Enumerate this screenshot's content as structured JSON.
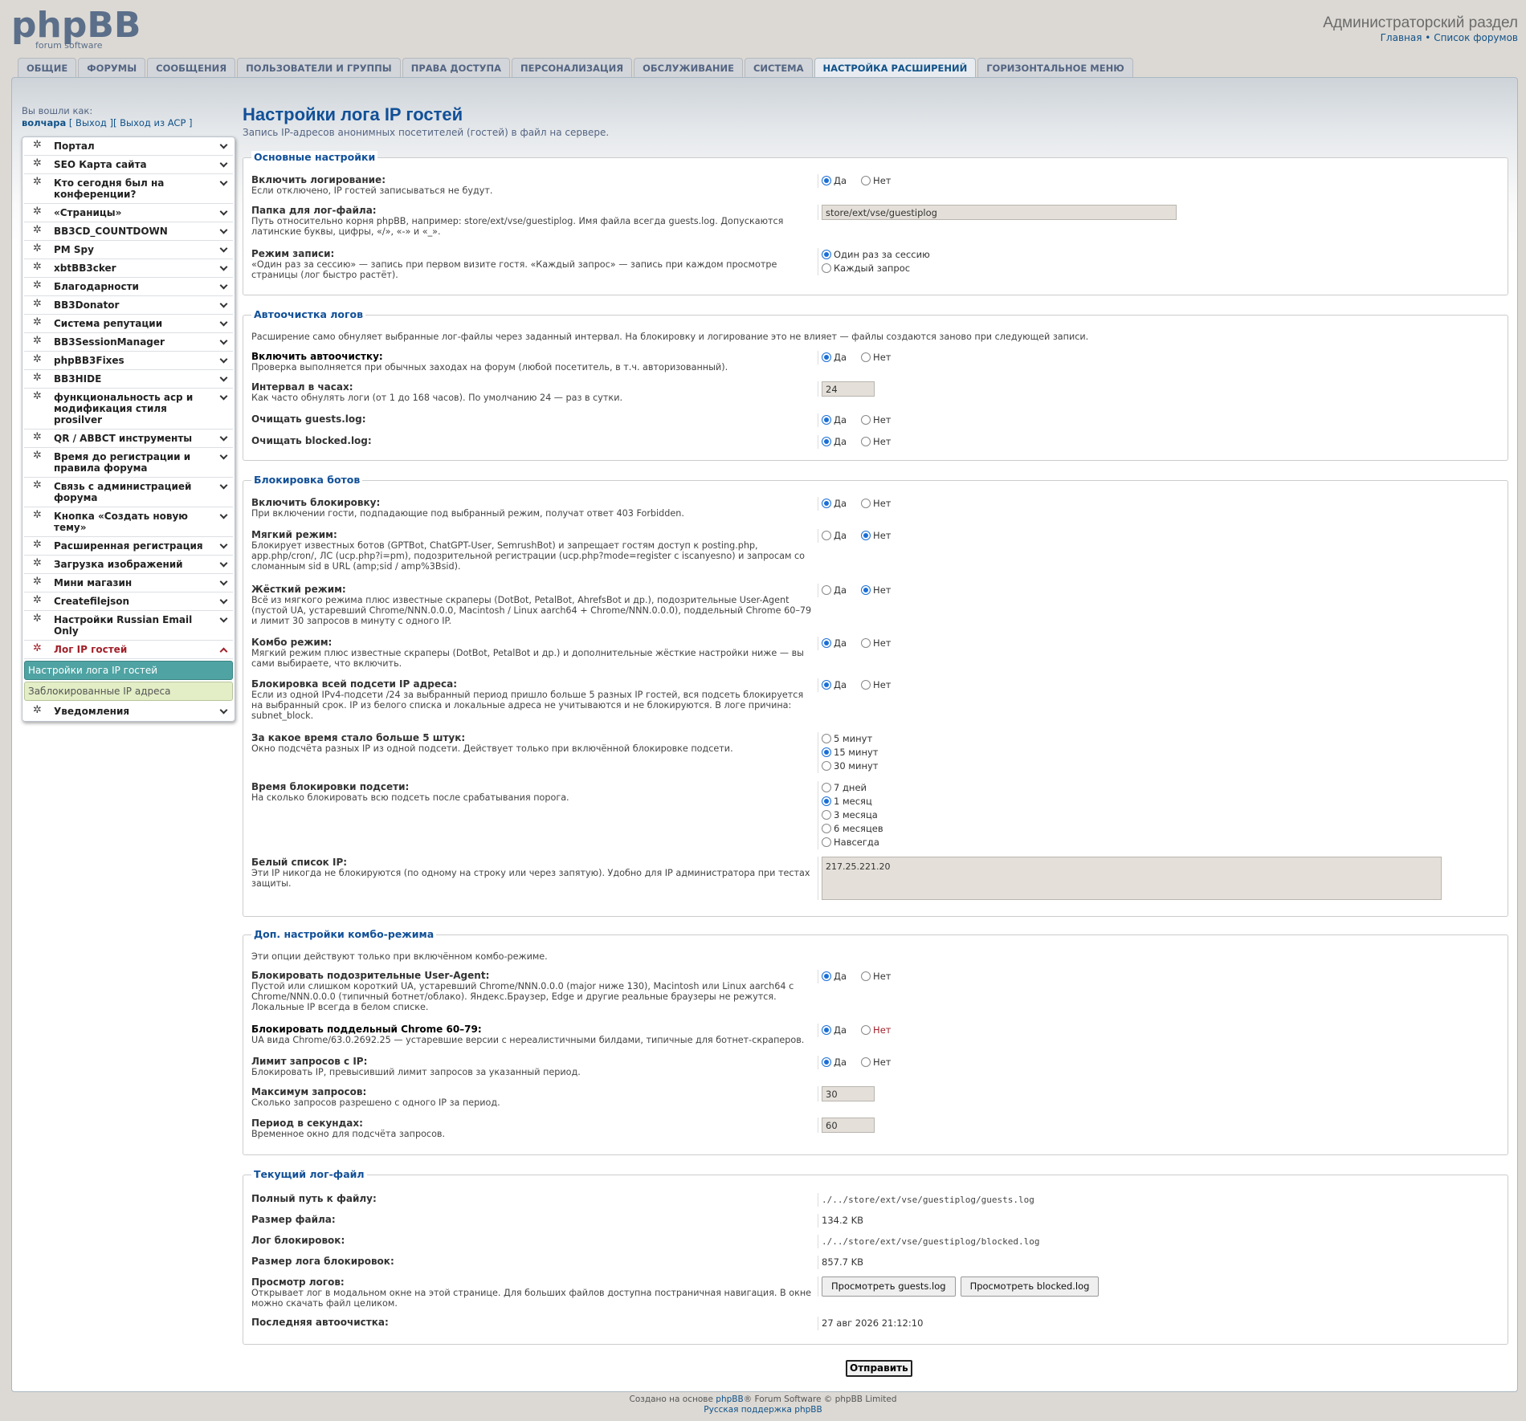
{
  "header": {
    "logo_text": "phpBB",
    "logo_sub": "forum software",
    "acp_title": "Администраторский раздел",
    "link_home": "Главная",
    "link_sep": "•",
    "link_forums": "Список форумов"
  },
  "tabs": [
    "Общие",
    "Форумы",
    "Сообщения",
    "Пользователи и группы",
    "Права доступа",
    "Персонализация",
    "Обслуживание",
    "Система",
    "Настройка расширений",
    "Горизонтальное меню"
  ],
  "login": {
    "label": "Вы вошли как:",
    "user": "волчара",
    "logout": "[ Выход ]",
    "logout_acp": "[ Выход из ACP ]"
  },
  "menu": [
    "Портал",
    "SEO Карта сайта",
    "Кто сегодня был на конференции?",
    "«Страницы»",
    "BB3CD_COUNTDOWN",
    "PM Spy",
    "xbtBB3cker",
    "Благодарности",
    "BB3Donator",
    "Система репутации",
    "BB3SessionManager",
    "phpBB3Fixes",
    "BB3HIDE",
    "функциональность acp и модификация стиля prosilver",
    "QR / ABBCT инструменты",
    "Время до регистрации и правила форума",
    "Связь с администрацией форума",
    "Кнопка «Создать новую тему»",
    "Расширенная регистрация",
    "Загрузка изображений",
    "Мини магазин",
    "Createfilejson",
    "Настройки Russian Email Only"
  ],
  "menu_open": "Лог IP гостей",
  "menu_sub_active": "Настройки лога IP гостей",
  "menu_sub_other": "Заблокированные IP адреса",
  "menu_last": "Уведомления",
  "page": {
    "title": "Настройки лога IP гостей",
    "desc": "Запись IP-адресов анонимных посетителей (гостей) в файл на сервере."
  },
  "yes": "Да",
  "no": "Нет",
  "basic": {
    "legend": "Основные настройки",
    "enable_t": "Включить логирование:",
    "enable_d": "Если отключено, IP гостей записываться не будут.",
    "folder_t": "Папка для лог-файла:",
    "folder_d": "Путь относительно корня phpBB, например: store/ext/vse/guestiplog. Имя файла всегда guests.log. Допускаются латинские буквы, цифры, «/», «-» и «_».",
    "folder_v": "store/ext/vse/guestiplog",
    "mode_t": "Режим записи:",
    "mode_d": "«Один раз за сессию» — запись при первом визите гостя. «Каждый запрос» — запись при каждом просмотре страницы (лог быстро растёт).",
    "mode_o1": "Один раз за сессию",
    "mode_o2": "Каждый запрос"
  },
  "clean": {
    "legend": "Автоочистка логов",
    "intro": "Расширение само обнуляет выбранные лог-файлы через заданный интервал. На блокировку и логирование это не влияет — файлы создаются заново при следующей записи.",
    "enable_t": "Включить автоочистку:",
    "enable_d": "Проверка выполняется при обычных заходах на форум (любой посетитель, в т.ч. авторизованный).",
    "interval_t": "Интервал в часах:",
    "interval_d": "Как часто обнулять логи (от 1 до 168 часов). По умолчанию 24 — раз в сутки.",
    "interval_v": "24",
    "guests_t": "Очищать guests.log:",
    "blocked_t": "Очищать blocked.log:"
  },
  "bots": {
    "legend": "Блокировка ботов",
    "enable_t": "Включить блокировку:",
    "enable_d": "При включении гости, подпадающие под выбранный режим, получат ответ 403 Forbidden.",
    "soft_t": "Мягкий режим:",
    "soft_d": "Блокирует известных ботов (GPTBot, ChatGPT-User, SemrushBot) и запрещает гостям доступ к posting.php, app.php/cron/, ЛС (ucp.php?i=pm), подозрительной регистрации (ucp.php?mode=register с iscanyesno) и запросам со сломанным sid в URL (amp;sid / amp%3Bsid).",
    "hard_t": "Жёсткий режим:",
    "hard_d": "Всё из мягкого режима плюс известные скраперы (DotBot, PetalBot, AhrefsBot и др.), подозрительные User-Agent (пустой UA, устаревший Chrome/NNN.0.0.0, Macintosh / Linux aarch64 + Chrome/NNN.0.0.0), поддельный Chrome 60–79 и лимит 30 запросов в минуту с одного IP.",
    "combo_t": "Комбо режим:",
    "combo_d": "Мягкий режим плюс известные скраперы (DotBot, PetalBot и др.) и дополнительные жёсткие настройки ниже — вы сами выбираете, что включить.",
    "subnet_t": "Блокировка всей подсети IP адреса:",
    "subnet_d": "Если из одной IPv4-подсети /24 за выбранный период пришло больше 5 разных IP гостей, вся подсеть блокируется на выбранный срок. IP из белого списка и локальные адреса не учитываются и не блокируются. В логе причина: subnet_block.",
    "window_t": "За какое время стало больше 5 штук:",
    "window_d": "Окно подсчёта разных IP из одной подсети. Действует только при включённой блокировке подсети.",
    "window_o": [
      "5 минут",
      "15 минут",
      "30 минут"
    ],
    "ban_t": "Время блокировки подсети:",
    "ban_d": "На сколько блокировать всю подсеть после срабатывания порога.",
    "ban_o": [
      "7 дней",
      "1 месяц",
      "3 месяца",
      "6 месяцев",
      "Навсегда"
    ],
    "white_t": "Белый список IP:",
    "white_d": "Эти IP никогда не блокируются (по одному на строку или через запятую). Удобно для IP администратора при тестах защиты.",
    "white_v": "217.25.221.20"
  },
  "combo": {
    "legend": "Доп. настройки комбо-режима",
    "intro": "Эти опции действуют только при включённом комбо-режиме.",
    "ua_t": "Блокировать подозрительные User-Agent:",
    "ua_d": "Пустой или слишком короткий UA, устаревший Chrome/NNN.0.0.0 (major ниже 130), Macintosh или Linux aarch64 с Chrome/NNN.0.0.0 (типичный ботнет/облако). Яндекс.Браузер, Edge и другие реальные браузеры не режутся. Локальные IP всегда в белом списке.",
    "chrome_t": "Блокировать поддельный Chrome 60–79:",
    "chrome_d": "UA вида Chrome/63.0.2692.25 — устаревшие версии с нереалистичными билдами, типичные для ботнет-скраперов.",
    "limit_t": "Лимит запросов с IP:",
    "limit_d": "Блокировать IP, превысивший лимит запросов за указанный период.",
    "max_t": "Максимум запросов:",
    "max_d": "Сколько запросов разрешено с одного IP за период.",
    "max_v": "30",
    "period_t": "Период в секундах:",
    "period_d": "Временное окно для подсчёта запросов.",
    "period_v": "60"
  },
  "current": {
    "legend": "Текущий лог-файл",
    "path_t": "Полный путь к файлу:",
    "path_v": "./../store/ext/vse/guestiplog/guests.log",
    "size_t": "Размер файла:",
    "size_v": "134.2 KB",
    "blog_t": "Лог блокировок:",
    "blog_v": "./../store/ext/vse/guestiplog/blocked.log",
    "bsize_t": "Размер лога блокировок:",
    "bsize_v": "857.7 KB",
    "view_t": "Просмотр логов:",
    "view_d": "Открывает лог в модальном окне на этой странице. Для больших файлов доступна постраничная навигация. В окне можно скачать файл целиком.",
    "view_b1": "Просмотреть guests.log",
    "view_b2": "Просмотреть blocked.log",
    "last_t": "Последняя автоочистка:",
    "last_v": "27 авг 2026 21:12:10"
  },
  "submit": "Отправить",
  "footer": {
    "pre": "Создано на основе",
    "phpbb": "phpBB",
    "post": "® Forum Software © phpBB Limited",
    "ru": "Русская поддержка phpBB"
  }
}
